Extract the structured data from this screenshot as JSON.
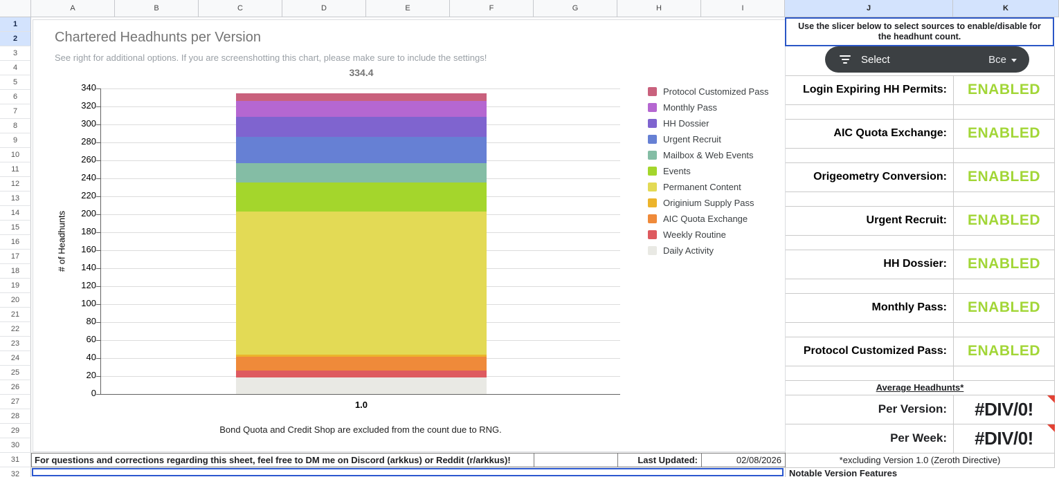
{
  "sheet": {
    "columns": [
      "A",
      "B",
      "C",
      "D",
      "E",
      "F",
      "G",
      "H",
      "I",
      "J",
      "K"
    ],
    "row_count": 32,
    "highlighted_columns": [
      "J",
      "K"
    ],
    "highlighted_rows": [
      1,
      2
    ]
  },
  "chart": {
    "title": "Chartered Headhunts per Version",
    "subtitle": "See right for additional options. If you are screenshotting this chart, please make sure to include the settings!",
    "total_label": "334.4",
    "footnote": "Bond Quota and Credit Shop are excluded from the count due to RNG."
  },
  "chart_data": {
    "type": "bar",
    "stacked": true,
    "title": "Chartered Headhunts per Version",
    "categories": [
      "1.0"
    ],
    "xlabel": "",
    "ylabel": "# of Headhunts",
    "ylim": [
      0,
      340
    ],
    "ytick_step": 20,
    "grid": true,
    "legend_position": "right",
    "total": 334.4,
    "series": [
      {
        "name": "Daily Activity",
        "values": [
          18.5
        ],
        "color": "#e9e9e4"
      },
      {
        "name": "Weekly Routine",
        "values": [
          7.7
        ],
        "color": "#de5a5f"
      },
      {
        "name": "AIC Quota Exchange",
        "values": [
          15.4
        ],
        "color": "#ef8a3a"
      },
      {
        "name": "Originium Supply Pass",
        "values": [
          2.3
        ],
        "color": "#ecb42c"
      },
      {
        "name": "Permanent Content",
        "values": [
          159.0
        ],
        "color": "#e3da55"
      },
      {
        "name": "Events",
        "values": [
          32.3
        ],
        "color": "#a4d62c"
      },
      {
        "name": "Mailbox & Web Events",
        "values": [
          21.5
        ],
        "color": "#84bda5"
      },
      {
        "name": "Urgent Recruit",
        "values": [
          29.2
        ],
        "color": "#6680d4"
      },
      {
        "name": "HH Dossier",
        "values": [
          22.3
        ],
        "color": "#7f64cf"
      },
      {
        "name": "Monthly Pass",
        "values": [
          17.7
        ],
        "color": "#b567d1"
      },
      {
        "name": "Protocol Customized Pass",
        "values": [
          8.5
        ],
        "color": "#c9617d"
      }
    ]
  },
  "right_panel": {
    "instruction": "Use the slicer below to select sources to enable/disable for the headhunt count.",
    "slicer": {
      "icon": "filter-icon",
      "label": "Select",
      "value": "Все",
      "caret": "caret-down-icon"
    },
    "toggles": [
      {
        "label": "Login Expiring HH Permits:",
        "value": "ENABLED"
      },
      {
        "label": "AIC Quota Exchange:",
        "value": "ENABLED"
      },
      {
        "label": "Origeometry Conversion:",
        "value": "ENABLED"
      },
      {
        "label": "Urgent Recruit:",
        "value": "ENABLED"
      },
      {
        "label": "HH Dossier:",
        "value": "ENABLED"
      },
      {
        "label": "Monthly Pass:",
        "value": "ENABLED"
      },
      {
        "label": "Protocol Customized Pass:",
        "value": "ENABLED"
      }
    ],
    "averages": {
      "title": "Average Headhunts*",
      "rows": [
        {
          "label": "Per Version:",
          "value": "#DIV/0!"
        },
        {
          "label": "Per Week:",
          "value": "#DIV/0!"
        }
      ],
      "footnote": "*excluding Version 1.0 (Zeroth Directive)"
    },
    "notable_header": "Notable Version Features"
  },
  "bottom_bar": {
    "message": "For questions and corrections regarding this sheet, feel free to DM me on Discord (arkkus) or Reddit (r/arkkus)!",
    "last_updated_label": "Last Updated:",
    "last_updated_value": "02/08/2026"
  },
  "colors": {
    "enabled_green": "#a2d637",
    "selection_blue": "#2a56c6",
    "error_red": "#e34335",
    "slicer_bg": "#3c4043",
    "header_highlight": "#d3e3fd"
  }
}
